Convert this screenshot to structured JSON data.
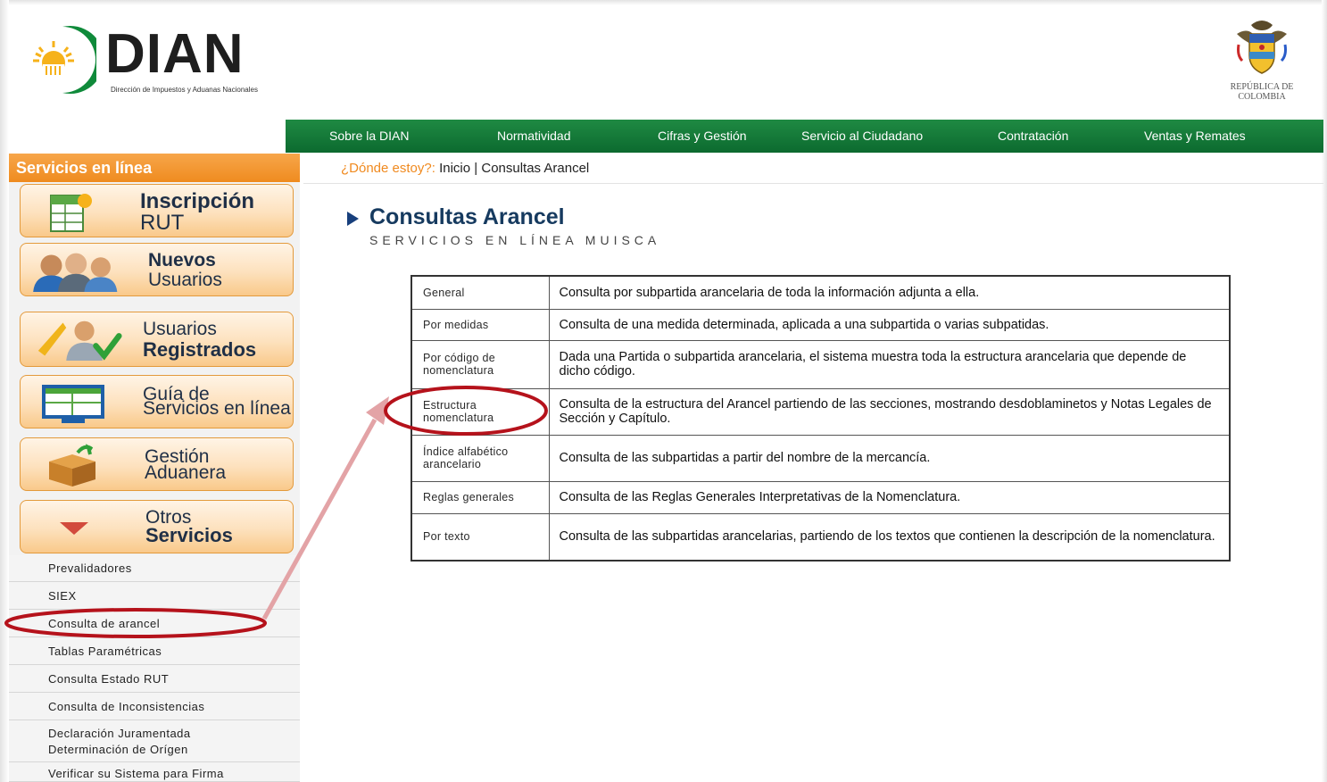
{
  "brand": {
    "name": "DIAN",
    "subtitle": "Dirección de Impuestos y Aduanas Nacionales"
  },
  "crest": {
    "line1": "REPÚBLICA DE",
    "line2": "COLOMBIA"
  },
  "nav": {
    "items": [
      "Sobre la DIAN",
      "Normatividad",
      "Cifras y Gestión",
      "Servicio al Ciudadano",
      "Contratación",
      "Ventas y Remates"
    ]
  },
  "sidebar": {
    "header": "Servicios en línea",
    "buttons": [
      {
        "line1": "Inscripción",
        "line2": "RUT",
        "icon": "form-icon"
      },
      {
        "line1": "Nuevos",
        "line2": "Usuarios",
        "icon": "users-icon"
      },
      {
        "line1": "Usuarios",
        "line2": "Registrados",
        "icon": "registered-user-icon"
      },
      {
        "line1": "Guía de",
        "line2": "Servicios en línea",
        "icon": "monitor-icon"
      },
      {
        "line1": "Gestión",
        "line2": "Aduanera",
        "icon": "package-icon"
      },
      {
        "line1": "Otros",
        "line2": "Servicios",
        "icon": "triangle-down-icon"
      }
    ],
    "menu": [
      "Prevalidadores",
      "SIEX",
      "Consulta de arancel",
      "Tablas Paramétricas",
      "Consulta Estado RUT",
      "Consulta de Inconsistencias",
      "Declaración Juramentada Determinación de Orígen",
      "Verificar su Sistema para Firma"
    ]
  },
  "breadcrumb": {
    "label": "¿Dónde estoy?:",
    "home": "Inicio",
    "separator": "|",
    "current": "Consultas Arancel"
  },
  "page": {
    "title": "Consultas Arancel",
    "subtitle": "SERVICIOS EN LÍNEA MUISCA"
  },
  "table": {
    "rows": [
      {
        "name": "General",
        "desc": "Consulta por subpartida arancelaria de toda la información adjunta a ella."
      },
      {
        "name": "Por medidas",
        "desc": "Consulta de una medida determinada, aplicada a una subpartida o varias subpatidas."
      },
      {
        "name": "Por código de nomenclatura",
        "desc": "Dada una Partida o subpartida arancelaria, el sistema muestra toda la estructura arancelaria que depende de dicho código."
      },
      {
        "name": "Estructura nomenclatura",
        "desc": "Consulta de la estructura del Arancel partiendo de las secciones, mostrando desdoblaminetos y Notas Legales de Sección y Capítulo."
      },
      {
        "name": "Índice alfabético arancelario",
        "desc": "Consulta de las subpartidas a partir del nombre de la mercancía."
      },
      {
        "name": "Reglas generales",
        "desc": "Consulta de las Reglas Generales Interpretativas de la Nomenclatura."
      },
      {
        "name": "Por texto",
        "desc": "Consulta de las subpartidas arancelarias, partiendo de los textos que contienen la descripción de la nomenclatura."
      }
    ]
  },
  "colors": {
    "nav_green": "#0c6a2f",
    "sidebar_orange": "#ef8b1f",
    "annotation_red": "#b5121b",
    "annotation_arrow": "#e3a3a6"
  }
}
